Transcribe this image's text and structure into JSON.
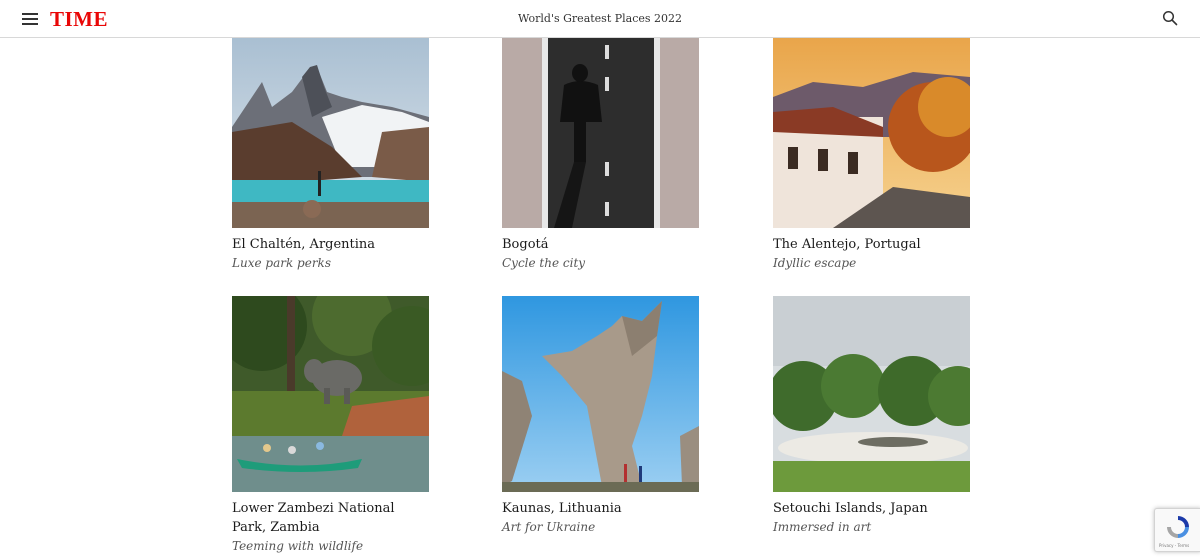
{
  "header": {
    "logo": "TIME",
    "title": "World's Greatest Places 2022",
    "menu_icon": "hamburger-menu-icon",
    "search_icon": "search-icon",
    "brand_color": "#e90606"
  },
  "places": [
    {
      "name": "El Chaltén, Argentina",
      "tagline": "Luxe park perks",
      "image": "mountain-lake-photo"
    },
    {
      "name": "Bogotá",
      "tagline": "Cycle the city",
      "image": "cyclist-bike-lane-photo"
    },
    {
      "name": "The Alentejo, Portugal",
      "tagline": "Idyllic escape",
      "image": "village-street-sunset-photo"
    },
    {
      "name": "Lower Zambezi National Park, Zambia",
      "tagline": "Teeming with wildlife",
      "image": "elephant-canoe-river-photo"
    },
    {
      "name": "Kaunas, Lithuania",
      "tagline": "Art for Ukraine",
      "image": "concrete-monument-photo"
    },
    {
      "name": "Setouchi Islands, Japan",
      "tagline": "Immersed in art",
      "image": "art-pavilion-field-photo"
    }
  ],
  "recaptcha": {
    "label": "Privacy - Terms"
  }
}
